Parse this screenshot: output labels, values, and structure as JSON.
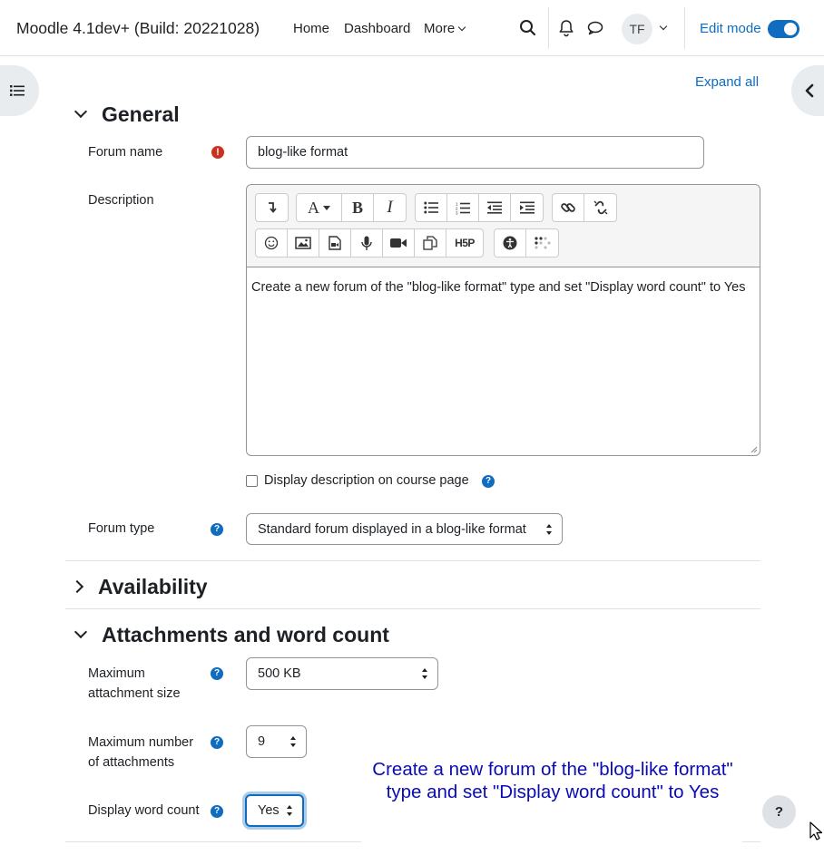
{
  "navbar": {
    "brand": "Moodle 4.1dev+ (Build: 20221028)",
    "links": [
      "Home",
      "Dashboard",
      "More"
    ],
    "avatar_initials": "TF",
    "edit_mode_label": "Edit mode",
    "edit_mode_on": true
  },
  "page": {
    "expand_all": "Expand all"
  },
  "general": {
    "title": "General",
    "forum_name_label": "Forum name",
    "forum_name_value": "blog-like format",
    "description_label": "Description",
    "description_text": "Create a new forum of the \"blog-like format\" type and set \"Display word count\" to Yes",
    "display_description_label": "Display description on course page",
    "display_description_checked": false,
    "forum_type_label": "Forum type",
    "forum_type_value": "Standard forum displayed in a blog-like format"
  },
  "editor_toolbar": {
    "row1": [
      "show-more-icon",
      "font-color-icon",
      "bold-icon",
      "italic-icon",
      "unordered-list-icon",
      "ordered-list-icon",
      "outdent-icon",
      "indent-icon",
      "link-icon",
      "unlink-icon"
    ],
    "row2": [
      "emoji-icon",
      "image-icon",
      "media-icon",
      "record-audio-icon",
      "record-video-icon",
      "manage-files-icon",
      "h5p-icon",
      "accessibility-checker-icon",
      "screenreader-helper-icon"
    ],
    "bold_glyph": "B",
    "italic_glyph": "I",
    "font_glyph": "A",
    "h5p_glyph": "H5P"
  },
  "availability": {
    "title": "Availability"
  },
  "attachments": {
    "title": "Attachments and word count",
    "max_size_label": "Maximum attachment size",
    "max_size_value": "500 KB",
    "max_number_label": "Maximum number of attachments",
    "max_number_value": "9",
    "word_count_label": "Display word count",
    "word_count_value": "Yes"
  },
  "task_overlay": "Create a new forum of the \"blog-like format\" type and set \"Display word count\" to Yes",
  "help_button_glyph": "?",
  "colors": {
    "accent": "#0f6cbf",
    "required": "#ca3120",
    "overlay_text": "#0b0bb5"
  }
}
